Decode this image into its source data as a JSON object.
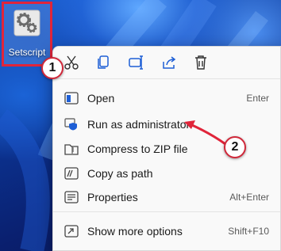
{
  "desktop": {
    "file_icon": "gear-file-icon",
    "file_label": "Setscript"
  },
  "toolbar": {
    "icons": [
      "cut-icon",
      "copy-icon",
      "rename-icon",
      "share-icon",
      "delete-icon"
    ]
  },
  "menu": {
    "items": [
      {
        "label": "Open",
        "shortcut": "Enter",
        "icon": "open-icon"
      },
      {
        "label": "Run as administrator",
        "shortcut": "",
        "icon": "shield-icon"
      },
      {
        "label": "Compress to ZIP file",
        "shortcut": "",
        "icon": "zip-folder-icon"
      },
      {
        "label": "Copy as path",
        "shortcut": "",
        "icon": "copy-path-icon"
      },
      {
        "label": "Properties",
        "shortcut": "Alt+Enter",
        "icon": "properties-icon"
      },
      {
        "label": "Show more options",
        "shortcut": "Shift+F10",
        "icon": "more-options-icon"
      }
    ]
  },
  "annotations": {
    "step1": "1",
    "step2": "2"
  },
  "colors": {
    "highlight": "#e0253a",
    "accent": "#1e5fd6",
    "menu_bg": "#f9f9f9"
  }
}
